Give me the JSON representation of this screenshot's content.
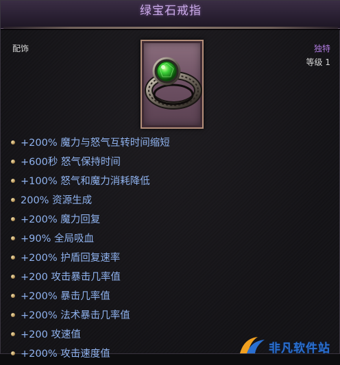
{
  "item": {
    "name": "绿宝石戒指",
    "slot": "配饰",
    "rarity": "独特",
    "level": "等级 1"
  },
  "stats": [
    "+200% 魔力与怒气互转时间缩短",
    "+600秒 怒气保持时间",
    "+100% 怒气和魔力消耗降低",
    "200% 资源生成",
    "+200% 魔力回复",
    "+90% 全局吸血",
    "+200% 护盾回复速率",
    "+200 攻击暴击几率值",
    "+200% 暴击几率值",
    "+200% 法术暴击几率值",
    "+200 攻速值",
    "+200% 攻击速度值"
  ],
  "watermark": {
    "text": "非凡软件站"
  },
  "colors": {
    "title": "#c9a9e6",
    "rarity": "#b07be0",
    "stat": "#8fb2ee",
    "gem": "#2fb52a"
  }
}
